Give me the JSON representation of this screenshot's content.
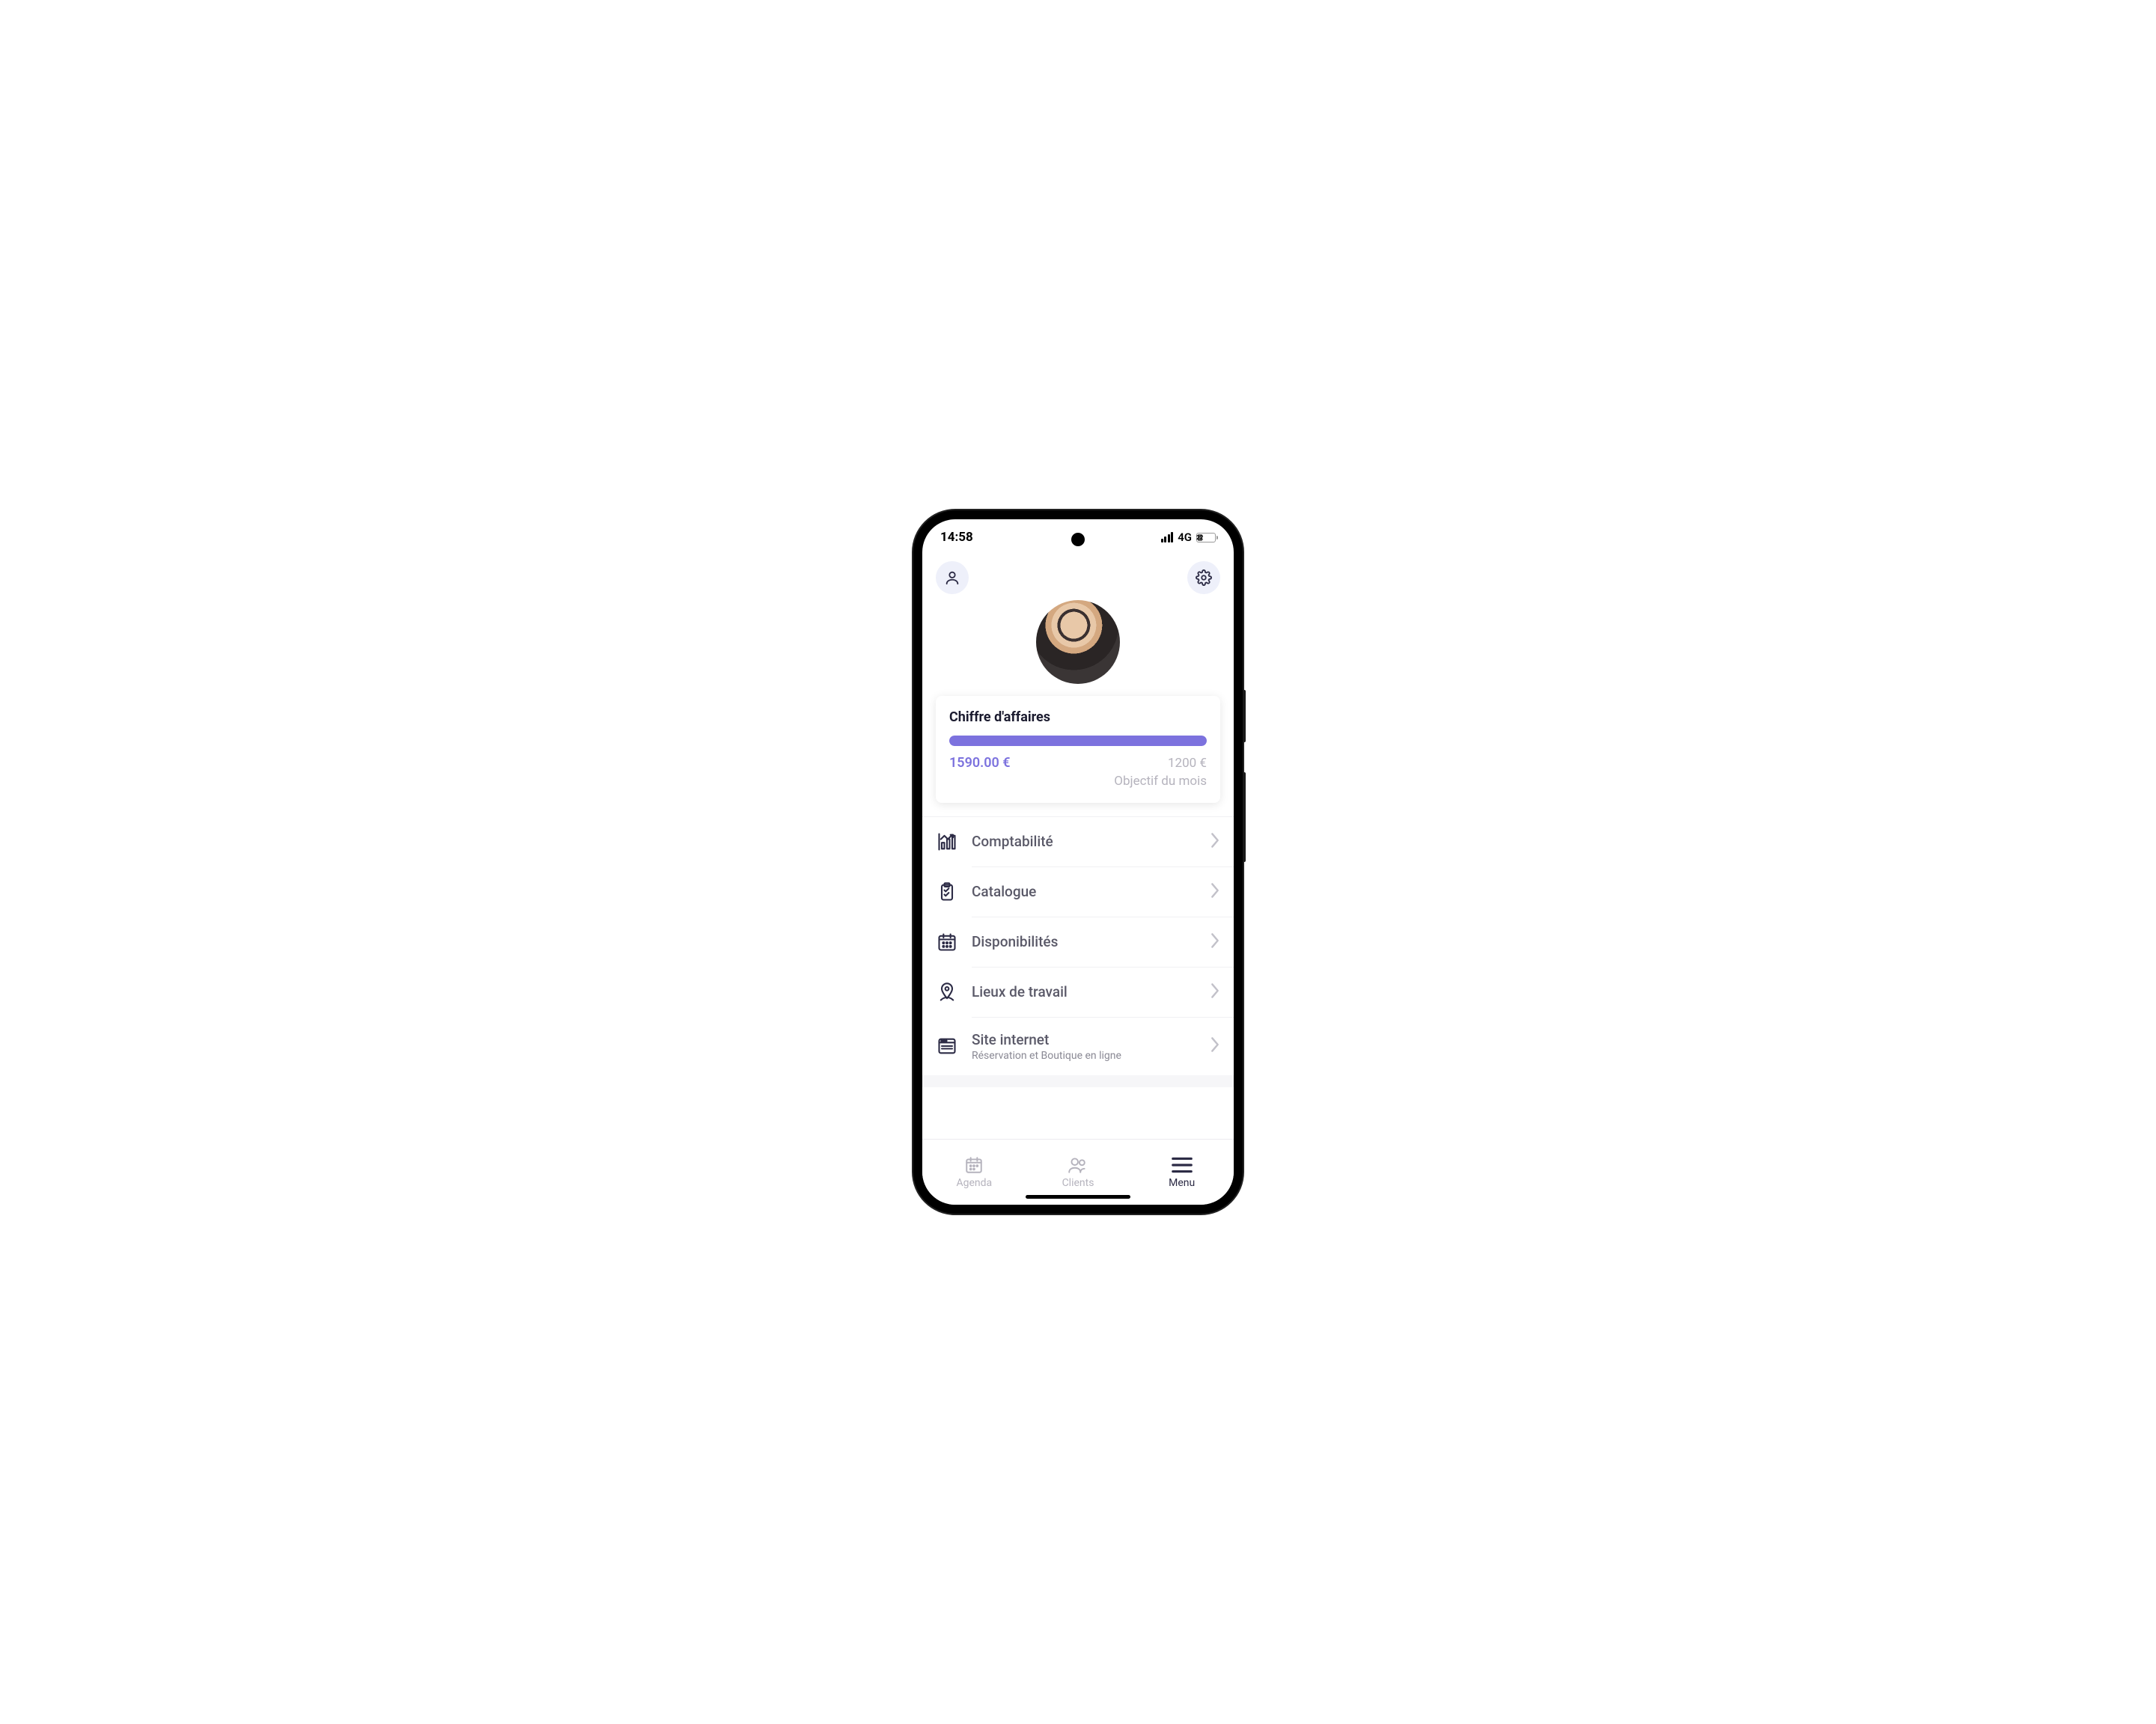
{
  "status": {
    "time": "14:58",
    "network": "4G",
    "battery": "22"
  },
  "revenue_card": {
    "title": "Chiffre d'affaires",
    "current": "1590.00 €",
    "target": "1200 €",
    "target_label": "Objectif du mois",
    "progress_pct": 100
  },
  "menu_items": [
    {
      "icon": "chart",
      "label": "Comptabilité",
      "sub": ""
    },
    {
      "icon": "clipboard",
      "label": "Catalogue",
      "sub": ""
    },
    {
      "icon": "calendar",
      "label": "Disponibilités",
      "sub": ""
    },
    {
      "icon": "pin",
      "label": "Lieux de travail",
      "sub": ""
    },
    {
      "icon": "browser",
      "label": "Site internet",
      "sub": "Réservation et Boutique en ligne"
    }
  ],
  "bottom_nav": [
    {
      "icon": "agenda",
      "label": "Agenda",
      "active": false
    },
    {
      "icon": "clients",
      "label": "Clients",
      "active": false
    },
    {
      "icon": "menu",
      "label": "Menu",
      "active": true
    }
  ],
  "colors": {
    "accent": "#7c72de",
    "icon_bg": "#eef0fa",
    "text_muted": "#b5b3bd",
    "text_dark": "#2c2b45"
  }
}
